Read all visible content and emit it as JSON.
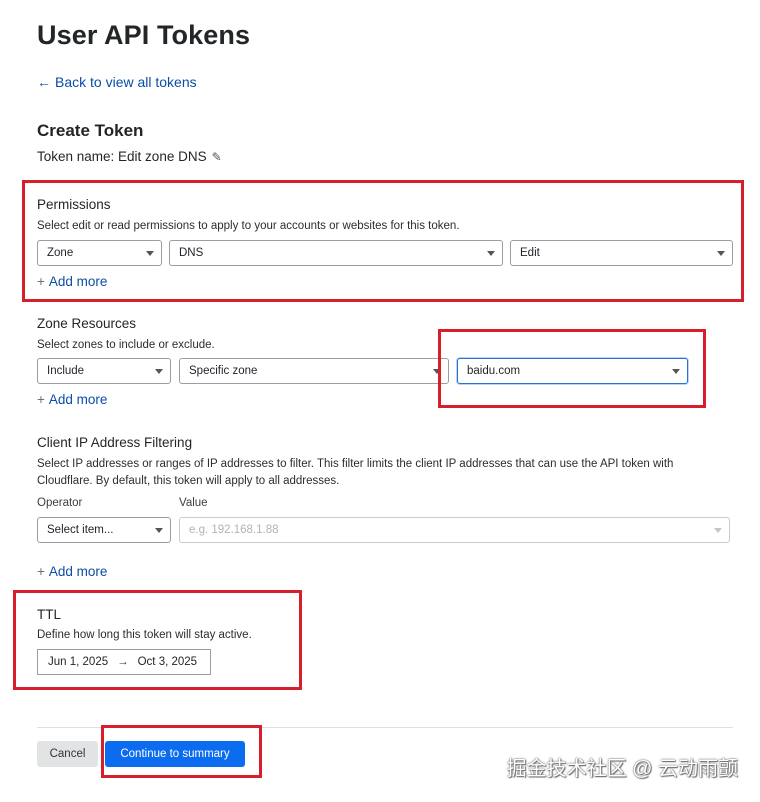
{
  "page": {
    "title": "User API Tokens",
    "back_link": "Back to view all tokens"
  },
  "create_token": {
    "heading": "Create Token",
    "token_name": "Token name: Edit zone DNS"
  },
  "permissions": {
    "label": "Permissions",
    "help": "Select edit or read permissions to apply to your accounts or websites for this token.",
    "selects": [
      "Zone",
      "DNS",
      "Edit"
    ],
    "add_more": "Add more"
  },
  "zone_resources": {
    "label": "Zone Resources",
    "help": "Select zones to include or exclude.",
    "selects": [
      "Include",
      "Specific zone",
      "baidu.com"
    ],
    "add_more": "Add more"
  },
  "ip_filtering": {
    "label": "Client IP Address Filtering",
    "help": "Select IP addresses or ranges of IP addresses to filter. This filter limits the client IP addresses that can use the API token with Cloudflare. By default, this token will apply to all addresses.",
    "operator_label": "Operator",
    "value_label": "Value",
    "operator_placeholder": "Select item...",
    "value_placeholder": "e.g. 192.168.1.88",
    "add_more": "Add more"
  },
  "ttl": {
    "label": "TTL",
    "help": "Define how long this token will stay active.",
    "start_date": "Jun 1, 2025",
    "end_date": "Oct 3, 2025"
  },
  "actions": {
    "cancel": "Cancel",
    "continue": "Continue to summary"
  },
  "watermark": "掘金技术社区 @ 云动雨颤",
  "icons": {
    "back": "arrow-left-icon",
    "edit": "pencil-icon",
    "add": "plus-icon",
    "dropdown": "chevron-down-icon",
    "range": "arrow-right-icon"
  },
  "colors": {
    "link": "#0a4ea8",
    "primary_button": "#0b6cf0",
    "highlight_box": "#d71e2b",
    "focus_border": "#2c6fd6"
  }
}
